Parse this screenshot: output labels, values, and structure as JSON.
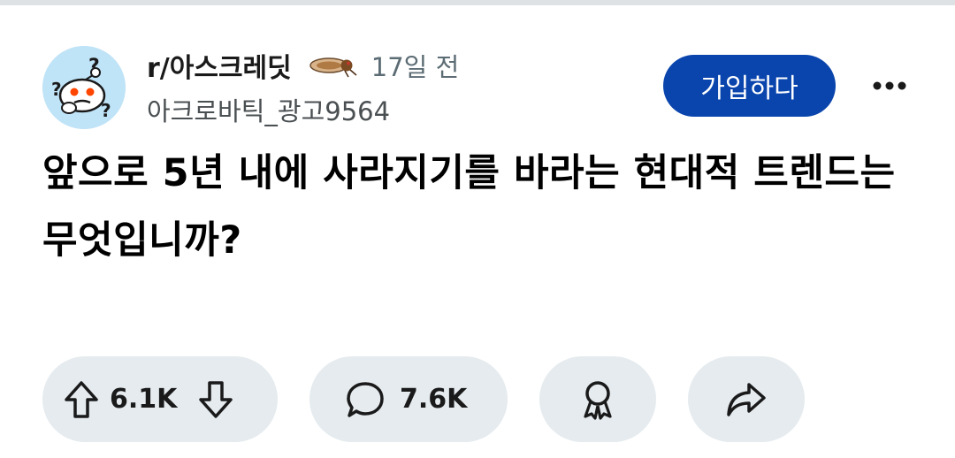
{
  "header": {
    "subreddit": "r/아스크레딧",
    "time_ago": "17일 전",
    "username": "아크로바틱_광고9564",
    "join_label": "가입하다"
  },
  "post": {
    "title": "앞으로 5년 내에 사라지기를 바라는 현대적 트렌드는 무엇입니까?"
  },
  "actions": {
    "vote_count": "6.1K",
    "comment_count": "7.6K"
  },
  "colors": {
    "join_button": "#0a45ad",
    "action_pill": "#e5ebee",
    "avatar_bg": "#bfe3f7"
  },
  "icons": [
    "subreddit-avatar-icon",
    "cicada-flair-icon",
    "more-options-icon",
    "upvote-arrow-icon",
    "downvote-arrow-icon",
    "comment-bubble-icon",
    "award-icon",
    "share-arrow-icon"
  ]
}
